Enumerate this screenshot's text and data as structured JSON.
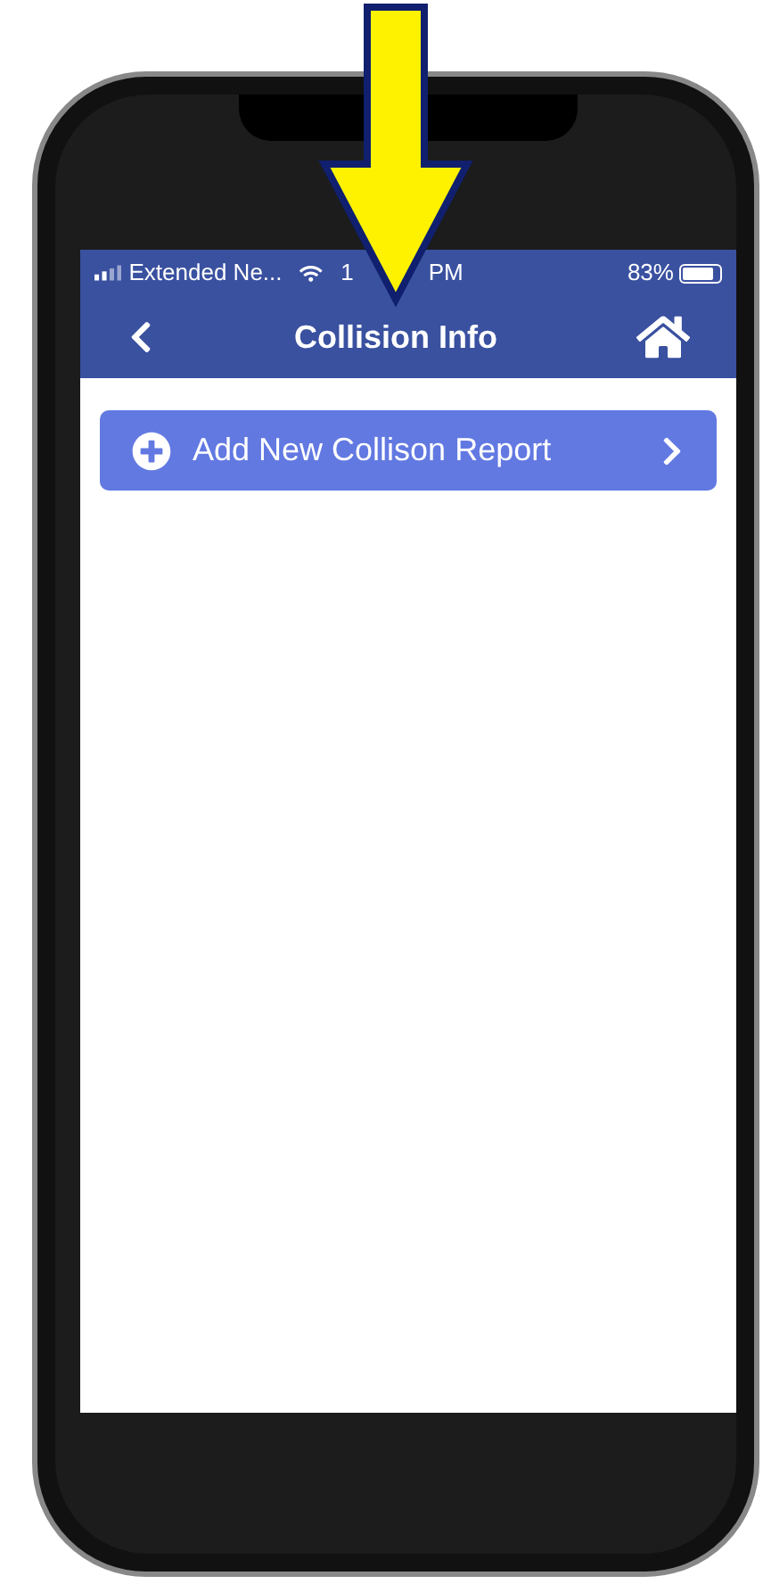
{
  "status_bar": {
    "carrier": "Extended Ne...",
    "time_visible": [
      "1",
      "PM"
    ],
    "battery": "83%",
    "level": 0.83
  },
  "header": {
    "title": "Collision Info"
  },
  "actions": [
    {
      "label": "Add New Collison Report"
    }
  ]
}
